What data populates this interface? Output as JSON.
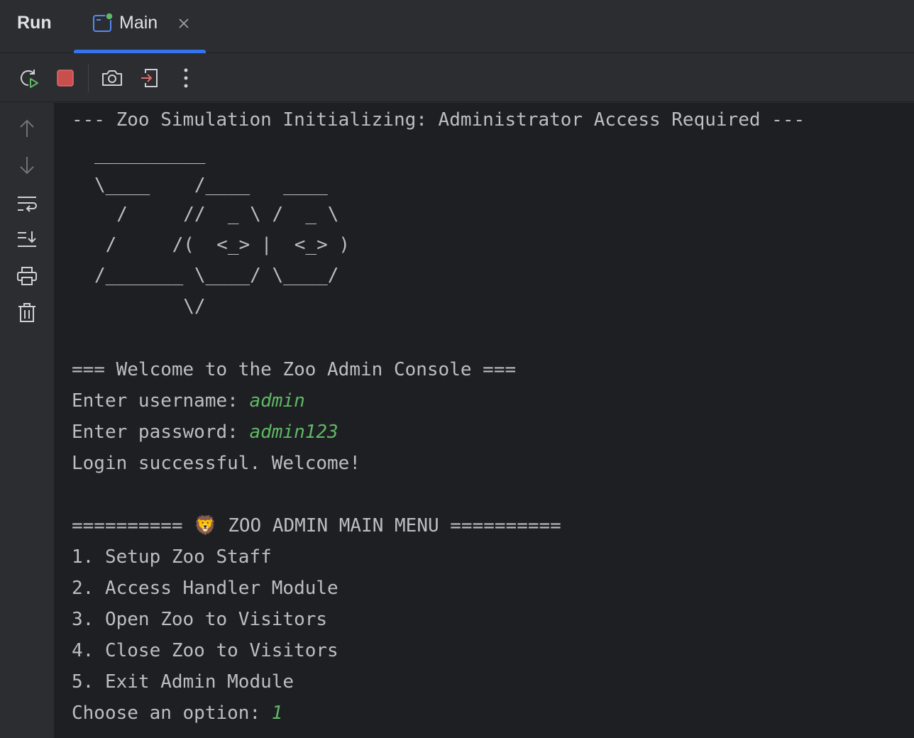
{
  "tabbar": {
    "run_label": "Run",
    "tab": {
      "label": "Main",
      "icon": "app-window-icon",
      "running_indicator_color": "#5fb865"
    }
  },
  "toolbar": {
    "buttons": [
      "rerun-icon",
      "stop-icon",
      "screenshot-icon",
      "exit-icon",
      "more-icon"
    ]
  },
  "gutter": {
    "buttons": [
      "up-arrow-icon",
      "down-arrow-icon",
      "soft-wrap-icon",
      "scroll-to-end-icon",
      "print-icon",
      "trash-icon"
    ]
  },
  "console": {
    "header": "--- Zoo Simulation Initializing: Administrator Access Required ---",
    "ascii_art": [
      "__________",
      "\\____    /____   ____",
      "  /     //  _ \\ /  _ \\",
      " /     /(  <_> |  <_> )",
      "/_______ \\____/ \\____/",
      "        \\/"
    ],
    "welcome": "=== Welcome to the Zoo Admin Console ===",
    "username_prompt": "Enter username: ",
    "username_value": "admin",
    "password_prompt": "Enter password: ",
    "password_value": "admin123",
    "login_message": "Login successful. Welcome!",
    "menu_title_left": "========== ",
    "menu_title_emoji": "🦁",
    "menu_title_right": " ZOO ADMIN MAIN MENU ==========",
    "menu_items": [
      "1. Setup Zoo Staff",
      "2. Access Handler Module",
      "3. Open Zoo to Visitors",
      "4. Close Zoo to Visitors",
      "5. Exit Admin Module"
    ],
    "choice_prompt": "Choose an option: ",
    "choice_value": "1",
    "input_color": "#5fb865"
  }
}
